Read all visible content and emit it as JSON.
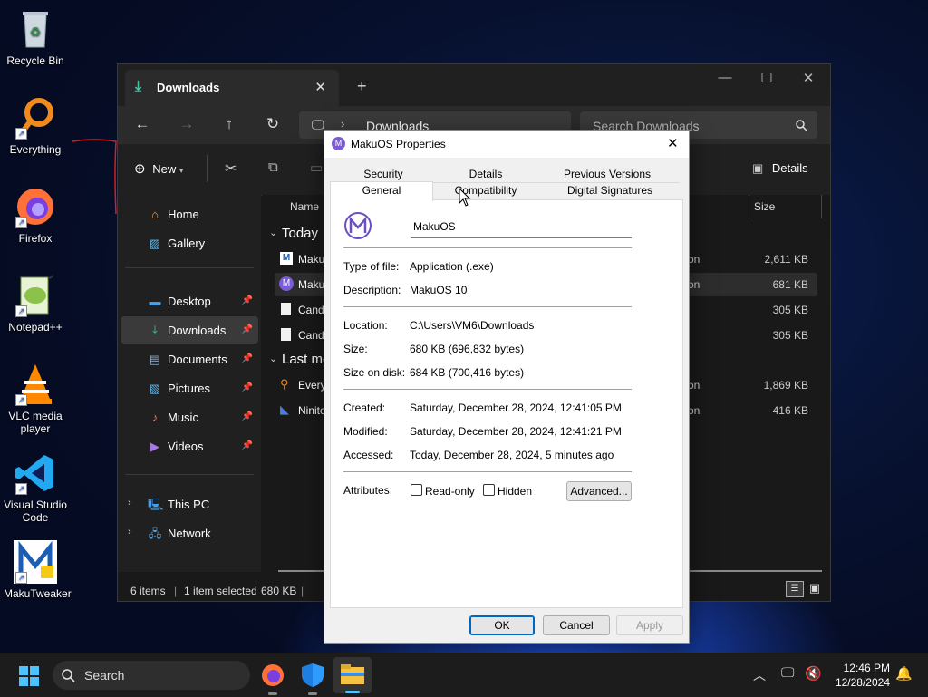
{
  "desktop": {
    "icons": [
      {
        "label": "Recycle Bin"
      },
      {
        "label": "Everything"
      },
      {
        "label": "Firefox"
      },
      {
        "label": "Notepad++"
      },
      {
        "label": "VLC media player"
      },
      {
        "label": "Visual Studio Code"
      },
      {
        "label": "MakuTweaker"
      }
    ]
  },
  "explorer": {
    "tab_title": "Downloads",
    "new_tab_label": "+",
    "address_path": "Downloads",
    "search_placeholder": "Search Downloads",
    "new_label": "New",
    "details_label": "Details",
    "sidebar": {
      "items": [
        {
          "label": "Home",
          "icon": "home-icon"
        },
        {
          "label": "Gallery",
          "icon": "gallery-icon"
        },
        {
          "label": "Desktop",
          "icon": "desktop-icon"
        },
        {
          "label": "Downloads",
          "icon": "download-icon"
        },
        {
          "label": "Documents",
          "icon": "documents-icon"
        },
        {
          "label": "Pictures",
          "icon": "pictures-icon"
        },
        {
          "label": "Music",
          "icon": "music-icon"
        },
        {
          "label": "Videos",
          "icon": "videos-icon"
        },
        {
          "label": "This PC",
          "icon": "pc-icon"
        },
        {
          "label": "Network",
          "icon": "network-icon"
        }
      ]
    },
    "columns": {
      "name": "Name",
      "size": "Size"
    },
    "groups": [
      "Today",
      "Last mo"
    ],
    "files": [
      {
        "name": "Maku",
        "type_fragment": "on",
        "size": "2,611 KB"
      },
      {
        "name": "Maku",
        "type_fragment": "on",
        "size": "681 KB"
      },
      {
        "name": "Cand",
        "type_fragment": "",
        "size": "305 KB"
      },
      {
        "name": "Cand",
        "type_fragment": "",
        "size": "305 KB"
      },
      {
        "name": "Every",
        "type_fragment": "on",
        "size": "1,869 KB"
      },
      {
        "name": "Ninite",
        "type_fragment": "on",
        "size": "416 KB"
      }
    ],
    "status": {
      "items": "6 items",
      "selected": "1 item selected",
      "selected_size": "680 KB",
      "sep": "|"
    }
  },
  "dialog": {
    "title": "MakuOS Properties",
    "tabs_row1": [
      "Security",
      "Details",
      "Previous Versions"
    ],
    "tabs_row2": [
      "General",
      "Compatibility",
      "Digital Signatures"
    ],
    "file_name": "MakuOS",
    "fields": {
      "type_label": "Type of file:",
      "type_value": "Application (.exe)",
      "desc_label": "Description:",
      "desc_value": "MakuOS 10",
      "location_label": "Location:",
      "location_value": "C:\\Users\\VM6\\Downloads",
      "size_label": "Size:",
      "size_value": "680 KB (696,832 bytes)",
      "disk_label": "Size on disk:",
      "disk_value": "684 KB (700,416 bytes)",
      "created_label": "Created:",
      "created_value": "Saturday, December 28, 2024, 12:41:05 PM",
      "modified_label": "Modified:",
      "modified_value": "Saturday, December 28, 2024, 12:41:21 PM",
      "accessed_label": "Accessed:",
      "accessed_value": "Today, December 28, 2024, 5 minutes ago",
      "attributes_label": "Attributes:",
      "readonly_label": "Read-only",
      "hidden_label": "Hidden"
    },
    "buttons": {
      "advanced": "Advanced...",
      "ok": "OK",
      "cancel": "Cancel",
      "apply": "Apply"
    }
  },
  "taskbar": {
    "search_label": "Search",
    "time": "12:46 PM",
    "date": "12/28/2024"
  },
  "colors": {
    "accent": "#0067c0",
    "explorer_bg": "#191919",
    "taskbar_bg": "#1c1c1c"
  }
}
